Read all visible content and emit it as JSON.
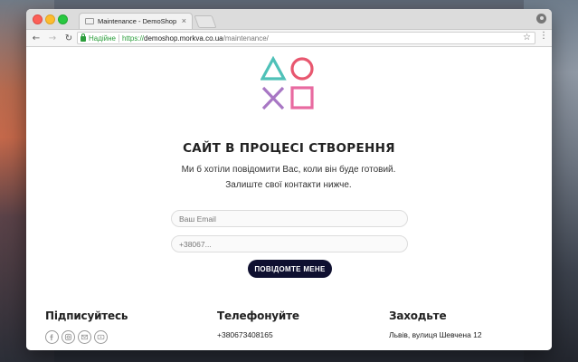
{
  "browser": {
    "tab_title": "Maintenance - DemoShop",
    "tab_close": "×",
    "secure_label": "Надійне",
    "url_scheme": "https://",
    "url_host": "demoshop.morkva.co.ua",
    "url_path": "/maintenance/",
    "nav": {
      "back": "←",
      "forward": "→",
      "reload": "↻"
    },
    "star": "☆",
    "menu": "⋮"
  },
  "page": {
    "title": "САЙТ В ПРОЦЕСІ СТВОРЕННЯ",
    "subtitle": "Ми б хотіли повідомити Вас, коли він буде готовий. Залиште свої контакти нижче.",
    "email_placeholder": "Ваш Email",
    "phone_placeholder": "+38067...",
    "submit_label": "ПОВІДОМТЕ МЕНЕ",
    "logo_colors": {
      "triangle": "#4fc1b8",
      "circle": "#e8576f",
      "cross": "#a877c4",
      "square": "#e86aa0"
    }
  },
  "footer": {
    "subscribe": {
      "heading": "Підписуйтесь",
      "icons": [
        "facebook-icon",
        "instagram-icon",
        "mail-icon",
        "youtube-icon"
      ]
    },
    "call": {
      "heading": "Телефонуйте",
      "phone": "+380673408165"
    },
    "visit": {
      "heading": "Заходьте",
      "address": "Львів, вулиця Шевчена 12"
    }
  }
}
